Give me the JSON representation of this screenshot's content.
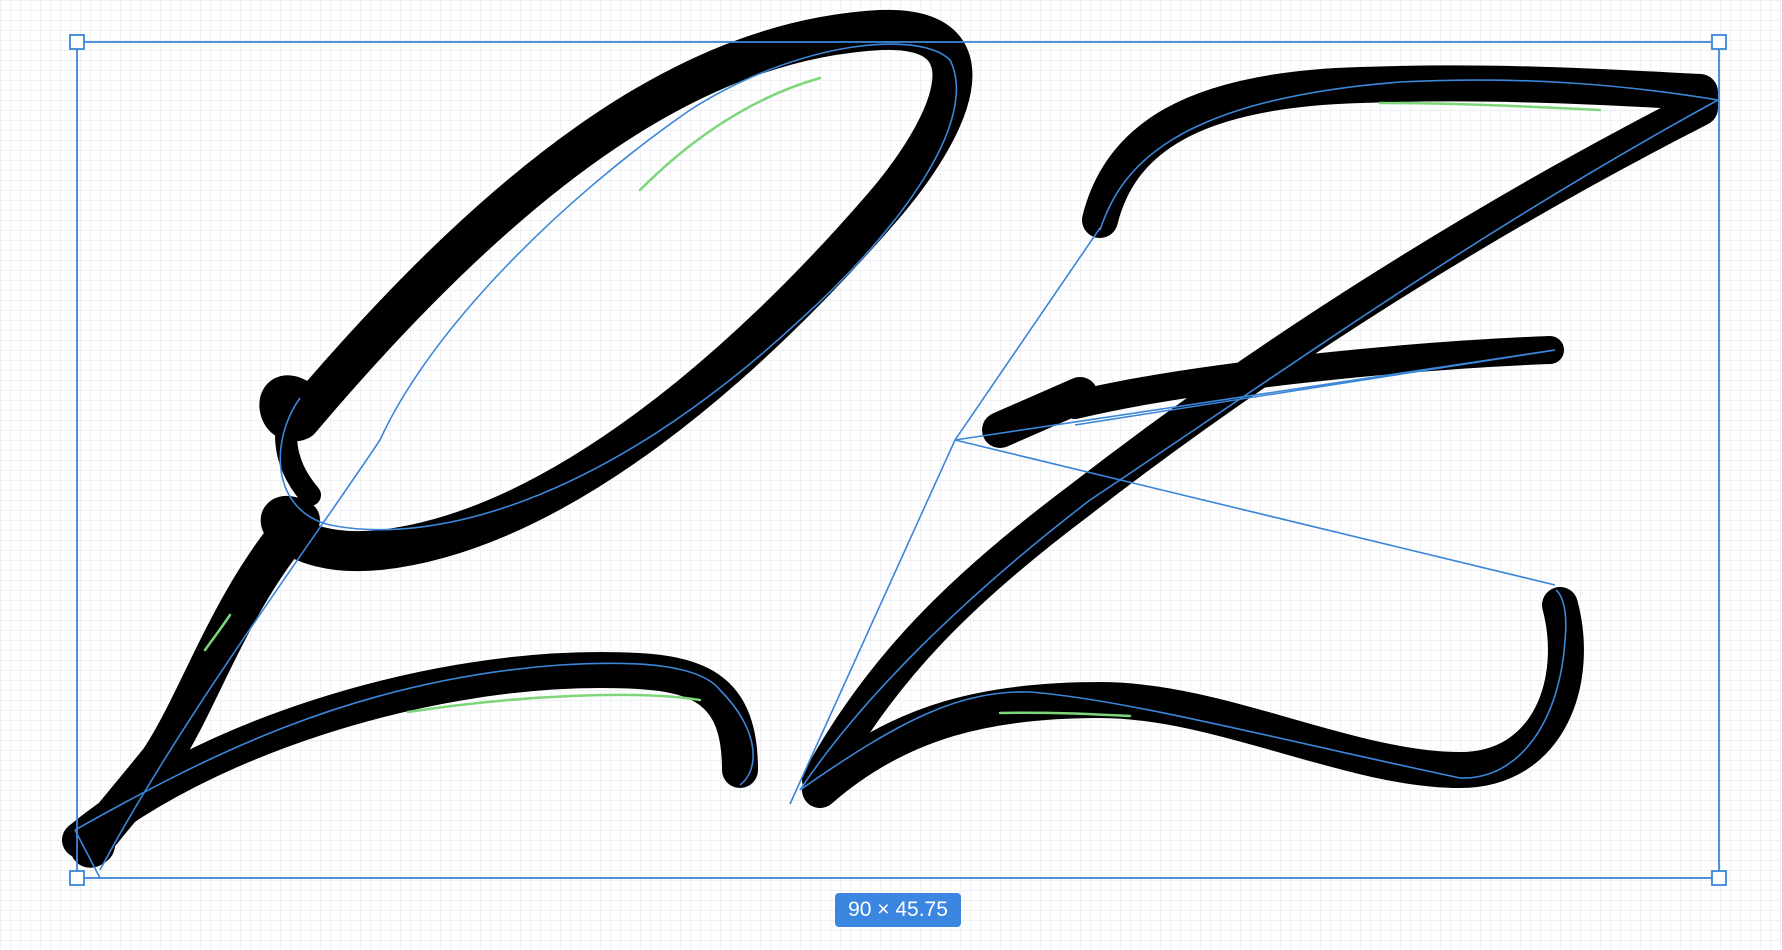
{
  "canvas": {
    "background": "#ffffff",
    "grid_color": "#eef0f3"
  },
  "artwork": {
    "letters": [
      "L",
      "Z"
    ],
    "stroke_color": "#000000",
    "path_color": "#3b86d8",
    "highlight_color": "#7ed67a"
  },
  "selection": {
    "color": "#3b86d8",
    "size_label": "90 × 45.75"
  }
}
